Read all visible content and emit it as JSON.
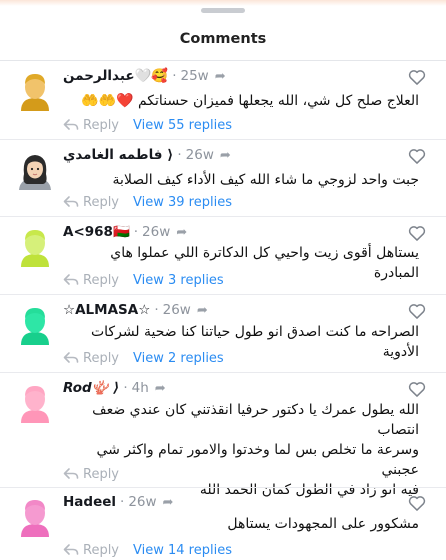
{
  "sheet": {
    "title": "Comments"
  },
  "colors": {
    "link": "#2b8cf2",
    "muted": "#8d939c",
    "heart": "#7d838c"
  },
  "comments": [
    {
      "avatar": {
        "skin": "#f1c36b",
        "body": "#d49b1a",
        "hair": "#e0a928"
      },
      "display_name": "عبدالرحمن🤍🥰",
      "age": "25w",
      "text": "العلاج صلح كل شي، الله يجعلها فميزان حسناتكم ❤️🤲🤲",
      "reply_label": "Reply",
      "view_replies": "View 55 replies"
    },
    {
      "avatar": {
        "type": "bitmoji-girl"
      },
      "display_name": "فاطمه الغامدي ⟩",
      "age": "26w",
      "text": "جبت واحد لزوجي ما شاء الله كيف الأداء كيف الصلابة",
      "reply_label": "Reply",
      "view_replies": "View 39 replies"
    },
    {
      "avatar": {
        "skin": "#d6f07a",
        "body": "#bfe23a",
        "hair": "#c8e84b"
      },
      "display_name": "A<968🇴🇲",
      "age": "26w",
      "text": "يستاهل أقوى زيت واحيي كل الدكاترة اللي عملوا هاي المبادرة",
      "reply_label": "Reply",
      "view_replies": "View 3 replies"
    },
    {
      "avatar": {
        "skin": "#2ee6a6",
        "body": "#18cf8c",
        "hair": "#25dd9a"
      },
      "display_name": "☆ALMASA☆",
      "age": "26w",
      "text": "الصراحه ما كنت اصدق انو طول حياتنا كنا ضحية لشركات الأدوية",
      "reply_label": "Reply",
      "view_replies": "View 2 replies"
    },
    {
      "avatar": {
        "skin": "#ffb3cc",
        "body": "#ff96b8",
        "hair": "#ffa6c3"
      },
      "display_name": "Rod🪸 ⟩",
      "age": "4h",
      "text_lines": [
        "الله يطول عمرك يا دكتور حرفيا انقذتني كان عندي ضعف انتصاب",
        "وسرعة ما تخلص بس لما وخدتوا والامور تمام واكثر شي عجبني",
        "فيه انو زاد في الطول كمان الحمد الله"
      ],
      "reply_label": "Reply"
    },
    {
      "avatar": {
        "skin": "#f59ad0",
        "body": "#ee6fbd",
        "hair": "#f288c7"
      },
      "display_name": "Hadeel",
      "age": "26w",
      "text": "مشكوور على المجهودات يستاهل",
      "reply_label": "Reply",
      "view_replies": "View 14 replies"
    }
  ]
}
